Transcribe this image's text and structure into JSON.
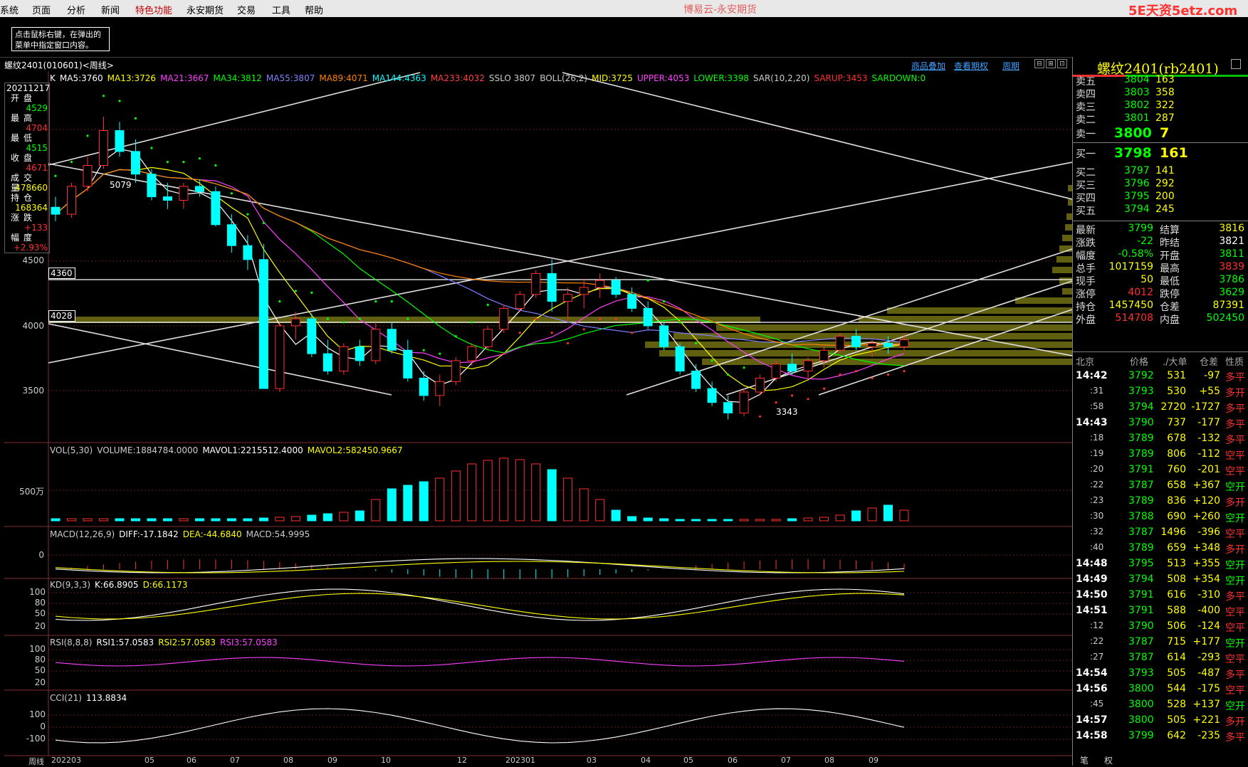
{
  "menu": {
    "items": [
      "系统",
      "页面",
      "分析",
      "新闻",
      "特色功能",
      "永安期货",
      "交易",
      "工具",
      "帮助"
    ],
    "title": "博易云-永安期货",
    "logo": "5E天资5etz.com"
  },
  "tip": "点击鼠标右键，在弹出的菜单中指定窗口内容。",
  "chart_header": {
    "title": "螺纹2401(010601)<周线>",
    "links": [
      "商品叠加",
      "查看期权",
      "周期"
    ],
    "nav_buttons": [
      "⊟",
      "⊞",
      "⊡"
    ]
  },
  "indicator_line": [
    {
      "text": "K",
      "color": "#ffffff"
    },
    {
      "text": "MA5:3760",
      "color": "#ffffff"
    },
    {
      "text": "MA13:3726",
      "color": "#ffff00"
    },
    {
      "text": "MA21:3667",
      "color": "#ff40ff"
    },
    {
      "text": "MA34:3812",
      "color": "#00ff00"
    },
    {
      "text": "MA55:3807",
      "color": "#8080ff"
    },
    {
      "text": "MA89:4071",
      "color": "#ff8000"
    },
    {
      "text": "MA144:4363",
      "color": "#00ffff"
    },
    {
      "text": "MA233:4032",
      "color": "#ff4040"
    },
    {
      "text": "SSLO 3807",
      "color": "#cccccc"
    },
    {
      "text": "BOLL(26,2)",
      "color": "#cccccc"
    },
    {
      "text": "MID:3725",
      "color": "#ffff00"
    },
    {
      "text": "UPPER:4053",
      "color": "#ff40ff"
    },
    {
      "text": "LOWER:3398",
      "color": "#00ff00"
    },
    {
      "text": "SAR(10,2,20)",
      "color": "#cccccc"
    },
    {
      "text": "SARUP:3453",
      "color": "#ff3030"
    },
    {
      "text": "SARDOWN:0",
      "color": "#00ff00"
    }
  ],
  "info": {
    "date": "20211217",
    "rows": [
      {
        "k": "开盘",
        "v": "4529",
        "c": "#00ff00"
      },
      {
        "k": "最高",
        "v": "4704",
        "c": "#ff3030"
      },
      {
        "k": "最低",
        "v": "4515",
        "c": "#00ff00"
      },
      {
        "k": "收盘",
        "v": "4671",
        "c": "#ff3030"
      },
      {
        "k": "成交量",
        "v": "478660",
        "c": "#ffff00"
      },
      {
        "k": "持仓",
        "v": "168364",
        "c": "#ffff00"
      },
      {
        "k": "涨跌",
        "v": "+133",
        "c": "#ff3030"
      },
      {
        "k": "幅度",
        "v": "+2.93%",
        "c": "#ff3030"
      }
    ]
  },
  "price_boxes": [
    "4360",
    "4028"
  ],
  "y_labels": [
    "4500",
    "4000",
    "3500"
  ],
  "price_annotations": [
    "5079",
    "3343"
  ],
  "volume": {
    "header": [
      {
        "text": "VOL(5,30)",
        "color": "#cccccc"
      },
      {
        "text": "VOLUME:1884784.0000",
        "color": "#cccccc"
      },
      {
        "text": "MAVOL1:2215512.4000",
        "color": "#ffffff"
      },
      {
        "text": "MAVOL2:582450.9667",
        "color": "#ffff00"
      }
    ],
    "y_label": "500万"
  },
  "macd": {
    "header": [
      {
        "text": "MACD(12,26,9)",
        "color": "#cccccc"
      },
      {
        "text": "DIFF:-17.1842",
        "color": "#ffffff"
      },
      {
        "text": "DEA:-44.6840",
        "color": "#ffff00"
      },
      {
        "text": "MACD:54.9995",
        "color": "#cccccc"
      }
    ],
    "y_label": "0"
  },
  "kd": {
    "header": [
      {
        "text": "KD(9,3,3)",
        "color": "#cccccc"
      },
      {
        "text": "K:66.8905",
        "color": "#ffffff"
      },
      {
        "text": "D:66.1173",
        "color": "#ffff00"
      }
    ],
    "y_labels": [
      "100",
      "80",
      "50",
      "20"
    ]
  },
  "rsi": {
    "header": [
      {
        "text": "RSI(8,8,8)",
        "color": "#cccccc"
      },
      {
        "text": "RSI1:57.0583",
        "color": "#ffffff"
      },
      {
        "text": "RSI2:57.0583",
        "color": "#ffff00"
      },
      {
        "text": "RSI3:57.0583",
        "color": "#ff40ff"
      }
    ],
    "y_labels": [
      "100",
      "80",
      "50",
      "20"
    ]
  },
  "cci": {
    "header": [
      {
        "text": "CCI(21)",
        "color": "#cccccc"
      },
      {
        "text": "113.8834",
        "color": "#ffffff"
      }
    ],
    "y_labels": [
      "100",
      "0",
      "-100"
    ]
  },
  "x_axis": {
    "corner": "周线",
    "labels": [
      "202203",
      "05",
      "06",
      "07",
      "08",
      "09",
      "10",
      "12",
      "202301",
      "03",
      "04",
      "05",
      "06",
      "07",
      "08",
      "09"
    ]
  },
  "right_panel": {
    "title": "螺纹2401(rb2401)",
    "asks": [
      {
        "k": "卖五",
        "p": "3804",
        "v": "163"
      },
      {
        "k": "卖四",
        "p": "3803",
        "v": "358"
      },
      {
        "k": "卖三",
        "p": "3802",
        "v": "322"
      },
      {
        "k": "卖二",
        "p": "3801",
        "v": "287"
      },
      {
        "k": "卖一",
        "p": "3800",
        "v": "7"
      }
    ],
    "bids": [
      {
        "k": "买一",
        "p": "3798",
        "v": "161"
      },
      {
        "k": "买二",
        "p": "3797",
        "v": "141"
      },
      {
        "k": "买三",
        "p": "3796",
        "v": "292"
      },
      {
        "k": "买四",
        "p": "3795",
        "v": "200"
      },
      {
        "k": "买五",
        "p": "3794",
        "v": "245"
      }
    ],
    "stats": [
      {
        "k1": "最新",
        "v1": "3799",
        "c1": "#00ff00",
        "k2": "结算",
        "v2": "3816",
        "c2": "#ffff00"
      },
      {
        "k1": "涨跌",
        "v1": "-22",
        "c1": "#00ff00",
        "k2": "昨结",
        "v2": "3821",
        "c2": "#ffffff"
      },
      {
        "k1": "幅度",
        "v1": "-0.58%",
        "c1": "#00ff00",
        "k2": "开盘",
        "v2": "3811",
        "c2": "#00ff00"
      },
      {
        "k1": "总手",
        "v1": "1017159",
        "c1": "#ffff00",
        "k2": "最高",
        "v2": "3839",
        "c2": "#ff3030"
      },
      {
        "k1": "现手",
        "v1": "50",
        "c1": "#ffff00",
        "k2": "最低",
        "v2": "3786",
        "c2": "#00ff00"
      },
      {
        "k1": "涨停",
        "v1": "4012",
        "c1": "#ff3030",
        "k2": "跌停",
        "v2": "3629",
        "c2": "#00ff00"
      },
      {
        "k1": "持仓",
        "v1": "1457450",
        "c1": "#ffff00",
        "k2": "仓差",
        "v2": "87391",
        "c2": "#ffff00"
      },
      {
        "k1": "外盘",
        "v1": "514708",
        "c1": "#ff3030",
        "k2": "内盘",
        "v2": "502450",
        "c2": "#00ff00"
      }
    ],
    "tick_header": {
      "time": "北京",
      "price": "价格",
      "vol": "./大单",
      "oi": "仓差",
      "nature": "性质"
    },
    "ticks": [
      {
        "t": "14:42",
        "p": "3792",
        "v": "531",
        "d": "-97",
        "n": "多平",
        "nc": "#ff3030",
        "big": true
      },
      {
        "t": ":31",
        "p": "3793",
        "v": "530",
        "d": "+55",
        "n": "多开",
        "nc": "#ff3030",
        "big": false
      },
      {
        "t": ":58",
        "p": "3794",
        "v": "2720",
        "d": "-1727",
        "n": "多平",
        "nc": "#ff3030",
        "big": false
      },
      {
        "t": "14:43",
        "p": "3790",
        "v": "737",
        "d": "-177",
        "n": "多平",
        "nc": "#ff3030",
        "big": true
      },
      {
        "t": ":18",
        "p": "3789",
        "v": "678",
        "d": "-132",
        "n": "多平",
        "nc": "#ff3030",
        "big": false
      },
      {
        "t": ":19",
        "p": "3789",
        "v": "806",
        "d": "-112",
        "n": "空平",
        "nc": "#ff3030",
        "big": false
      },
      {
        "t": ":20",
        "p": "3791",
        "v": "760",
        "d": "-201",
        "n": "空平",
        "nc": "#ff3030",
        "big": false
      },
      {
        "t": ":22",
        "p": "3787",
        "v": "658",
        "d": "+367",
        "n": "空开",
        "nc": "#00ff00",
        "big": false
      },
      {
        "t": ":23",
        "p": "3789",
        "v": "836",
        "d": "+120",
        "n": "多开",
        "nc": "#ff3030",
        "big": false
      },
      {
        "t": ":30",
        "p": "3788",
        "v": "690",
        "d": "+260",
        "n": "空开",
        "nc": "#00ff00",
        "big": false
      },
      {
        "t": ":32",
        "p": "3787",
        "v": "1496",
        "d": "-396",
        "n": "空平",
        "nc": "#ff3030",
        "big": false
      },
      {
        "t": ":40",
        "p": "3789",
        "v": "659",
        "d": "+348",
        "n": "多开",
        "nc": "#ff3030",
        "big": false
      },
      {
        "t": "14:48",
        "p": "3795",
        "v": "513",
        "d": "+355",
        "n": "空开",
        "nc": "#00ff00",
        "big": true
      },
      {
        "t": "14:49",
        "p": "3794",
        "v": "508",
        "d": "+354",
        "n": "空开",
        "nc": "#00ff00",
        "big": true
      },
      {
        "t": "14:50",
        "p": "3791",
        "v": "616",
        "d": "-310",
        "n": "多平",
        "nc": "#ff3030",
        "big": true
      },
      {
        "t": "14:51",
        "p": "3791",
        "v": "588",
        "d": "-400",
        "n": "空平",
        "nc": "#ff3030",
        "big": true
      },
      {
        "t": ":12",
        "p": "3790",
        "v": "506",
        "d": "-124",
        "n": "空平",
        "nc": "#ff3030",
        "big": false
      },
      {
        "t": ":22",
        "p": "3787",
        "v": "715",
        "d": "+177",
        "n": "空开",
        "nc": "#00ff00",
        "big": false
      },
      {
        "t": ":27",
        "p": "3787",
        "v": "614",
        "d": "-293",
        "n": "空平",
        "nc": "#ff3030",
        "big": false
      },
      {
        "t": "14:54",
        "p": "3793",
        "v": "505",
        "d": "-487",
        "n": "多平",
        "nc": "#ff3030",
        "big": true
      },
      {
        "t": "14:56",
        "p": "3800",
        "v": "544",
        "d": "-175",
        "n": "空平",
        "nc": "#ff3030",
        "big": true
      },
      {
        "t": ":45",
        "p": "3800",
        "v": "528",
        "d": "+137",
        "n": "空开",
        "nc": "#00ff00",
        "big": false
      },
      {
        "t": "14:57",
        "p": "3800",
        "v": "505",
        "d": "+221",
        "n": "多开",
        "nc": "#ff3030",
        "big": true
      },
      {
        "t": "14:58",
        "p": "3799",
        "v": "642",
        "d": "-235",
        "n": "多平",
        "nc": "#ff3030",
        "big": true
      }
    ],
    "bottom_tabs": [
      "笔",
      "权"
    ]
  },
  "chart_data": {
    "type": "candlestick",
    "period": "weekly",
    "ylim": [
      3300,
      5300
    ],
    "candles": [
      [
        4560,
        4620,
        4480,
        4520
      ],
      [
        4520,
        4700,
        4500,
        4680
      ],
      [
        4680,
        4850,
        4650,
        4800
      ],
      [
        4800,
        5079,
        4780,
        5000
      ],
      [
        5000,
        5050,
        4850,
        4880
      ],
      [
        4880,
        4950,
        4700,
        4750
      ],
      [
        4750,
        4780,
        4600,
        4620
      ],
      [
        4620,
        4700,
        4550,
        4600
      ],
      [
        4600,
        4700,
        4550,
        4680
      ],
      [
        4680,
        4720,
        4620,
        4650
      ],
      [
        4650,
        4680,
        4450,
        4460
      ],
      [
        4460,
        4520,
        4300,
        4340
      ],
      [
        4340,
        4400,
        4200,
        4260
      ],
      [
        4260,
        4350,
        3520,
        3520
      ],
      [
        3520,
        3900,
        3500,
        3880
      ],
      [
        3880,
        3960,
        3800,
        3920
      ],
      [
        3920,
        3950,
        3700,
        3720
      ],
      [
        3720,
        3800,
        3600,
        3620
      ],
      [
        3620,
        3780,
        3600,
        3760
      ],
      [
        3760,
        3800,
        3650,
        3680
      ],
      [
        3680,
        3900,
        3660,
        3860
      ],
      [
        3860,
        3900,
        3720,
        3740
      ],
      [
        3740,
        3800,
        3560,
        3580
      ],
      [
        3580,
        3620,
        3450,
        3480
      ],
      [
        3480,
        3600,
        3420,
        3560
      ],
      [
        3560,
        3700,
        3540,
        3680
      ],
      [
        3680,
        3780,
        3650,
        3760
      ],
      [
        3760,
        3880,
        3740,
        3860
      ],
      [
        3860,
        4000,
        3840,
        3980
      ],
      [
        3980,
        4080,
        3960,
        4060
      ],
      [
        4060,
        4200,
        4040,
        4180
      ],
      [
        4180,
        4260,
        3960,
        4020
      ],
      [
        4020,
        4100,
        3900,
        4060
      ],
      [
        4060,
        4150,
        3980,
        4100
      ],
      [
        4100,
        4180,
        4040,
        4140
      ],
      [
        4140,
        4160,
        4040,
        4060
      ],
      [
        4060,
        4100,
        3960,
        3980
      ],
      [
        3980,
        4020,
        3860,
        3880
      ],
      [
        3880,
        3900,
        3740,
        3760
      ],
      [
        3760,
        3780,
        3600,
        3620
      ],
      [
        3620,
        3660,
        3500,
        3520
      ],
      [
        3520,
        3560,
        3420,
        3440
      ],
      [
        3440,
        3480,
        3343,
        3380
      ],
      [
        3380,
        3520,
        3360,
        3500
      ],
      [
        3500,
        3600,
        3480,
        3580
      ],
      [
        3580,
        3680,
        3560,
        3660
      ],
      [
        3660,
        3720,
        3600,
        3620
      ],
      [
        3620,
        3700,
        3580,
        3680
      ],
      [
        3680,
        3760,
        3640,
        3740
      ],
      [
        3740,
        3840,
        3720,
        3820
      ],
      [
        3820,
        3860,
        3740,
        3760
      ],
      [
        3760,
        3800,
        3700,
        3780
      ],
      [
        3780,
        3820,
        3720,
        3760
      ],
      [
        3760,
        3840,
        3740,
        3800
      ]
    ]
  }
}
